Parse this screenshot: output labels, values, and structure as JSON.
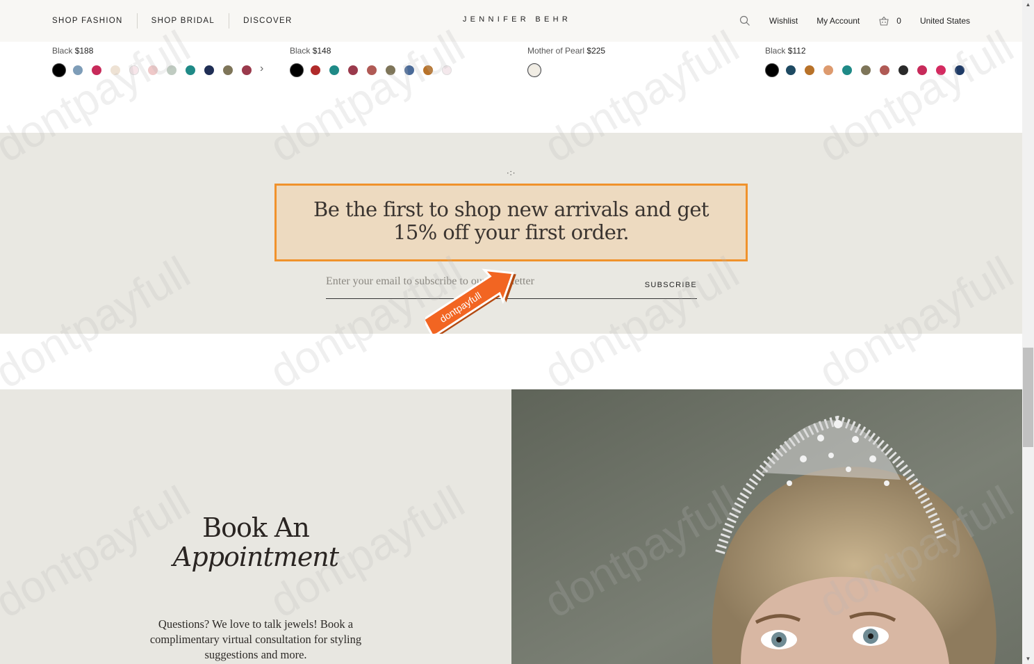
{
  "header": {
    "nav": [
      "SHOP FASHION",
      "SHOP BRIDAL",
      "DISCOVER"
    ],
    "brand": "JENNIFER BEHR",
    "wishlist": "Wishlist",
    "account": "My Account",
    "cart_count": "0",
    "region": "United States"
  },
  "products": [
    {
      "color": "Black",
      "price": "$188",
      "swatches": [
        "#000000",
        "#7e9db8",
        "#c72a5a",
        "#eee2d4",
        "#f7e6ea",
        "#efc8c8",
        "#bfcbc1",
        "#1f8a87",
        "#1f2e55",
        "#7e7559",
        "#9a3a4c"
      ],
      "more": true
    },
    {
      "color": "Black",
      "price": "$148",
      "swatches": [
        "#000000",
        "#b02a2a",
        "#1f8a87",
        "#9a3a4c",
        "#b05a55",
        "#7e7559",
        "#4a6a98",
        "#b87229",
        "#f4e8ec"
      ],
      "more": false
    },
    {
      "color": "Mother of Pearl",
      "price": "$225",
      "swatches": [
        "#f1ede4"
      ],
      "more": false
    },
    {
      "color": "Black",
      "price": "$112",
      "swatches": [
        "#000000",
        "#1e4a62",
        "#b87229",
        "#dd9a6e",
        "#1f8a87",
        "#7e7559",
        "#b05a55",
        "#2a2a2a",
        "#c72a5a",
        "#d42a60",
        "#1e3a66"
      ],
      "more": false
    }
  ],
  "newsletter": {
    "headline": "Be the first to shop new arrivals and get 15% off your first order.",
    "placeholder": "Enter your email to subscribe to our newsletter",
    "button": "SUBSCRIBE",
    "badge": "dontpayfull"
  },
  "appointment": {
    "title_line1": "Book An",
    "title_line2": "Appointment",
    "description": "Questions? We love to talk jewels! Book a complimentary virtual consultation for styling suggestions and more."
  },
  "watermark": "dontpayfull",
  "colors": {
    "accent_orange": "#f0922c",
    "promo_fill": "#eddac0",
    "section_bg": "#e9e8e2"
  }
}
